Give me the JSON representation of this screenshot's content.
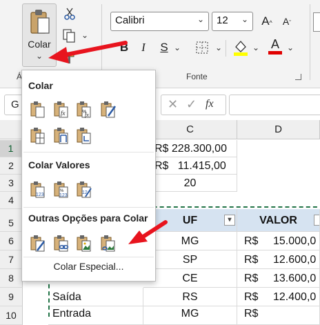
{
  "ribbon": {
    "paste_label": "Colar",
    "paste_chevron": "⌄",
    "clipboard_group_label": "Ár",
    "font_group_label": "Fonte",
    "font_name": "Calibri",
    "font_size": "12",
    "bold": "B",
    "italic": "I",
    "underline": "S",
    "font_color_letter": "A",
    "fill_color": "#ffff00",
    "font_color": "#e00000"
  },
  "formula_bar": {
    "name_box": "G",
    "fx": "fx"
  },
  "columns": [
    "C",
    "D"
  ],
  "rows": [
    {
      "num": "1",
      "c": "R$ 228.300,00",
      "d": ""
    },
    {
      "num": "2",
      "c": "R$   11.415,00",
      "d": ""
    },
    {
      "num": "3",
      "c": "20",
      "d": ""
    },
    {
      "num": "4",
      "c": "",
      "d": ""
    },
    {
      "num": "5",
      "b": "",
      "c": "UF",
      "d": "VALOR"
    },
    {
      "num": "6",
      "b": "",
      "c": "MG",
      "d_cur": "R$",
      "d": "15.000,0"
    },
    {
      "num": "7",
      "b": "",
      "c": "SP",
      "d_cur": "R$",
      "d": "12.600,0"
    },
    {
      "num": "8",
      "b": "",
      "c": "CE",
      "d_cur": "R$",
      "d": "13.600,0"
    },
    {
      "num": "9",
      "b": "Saída",
      "c": "RS",
      "d_cur": "R$",
      "d": "12.400,0"
    },
    {
      "num": "10",
      "b": "Entrada",
      "c": "MG",
      "d_cur": "R$",
      "d": ""
    }
  ],
  "menu": {
    "section1": "Colar",
    "section2": "Colar Valores",
    "section3": "Outras Opções para Colar",
    "special": "Colar Especial..."
  },
  "colors": {
    "accent_green": "#217346",
    "arrow_red": "#e8141e",
    "header_fill": "#d6e3f1"
  }
}
